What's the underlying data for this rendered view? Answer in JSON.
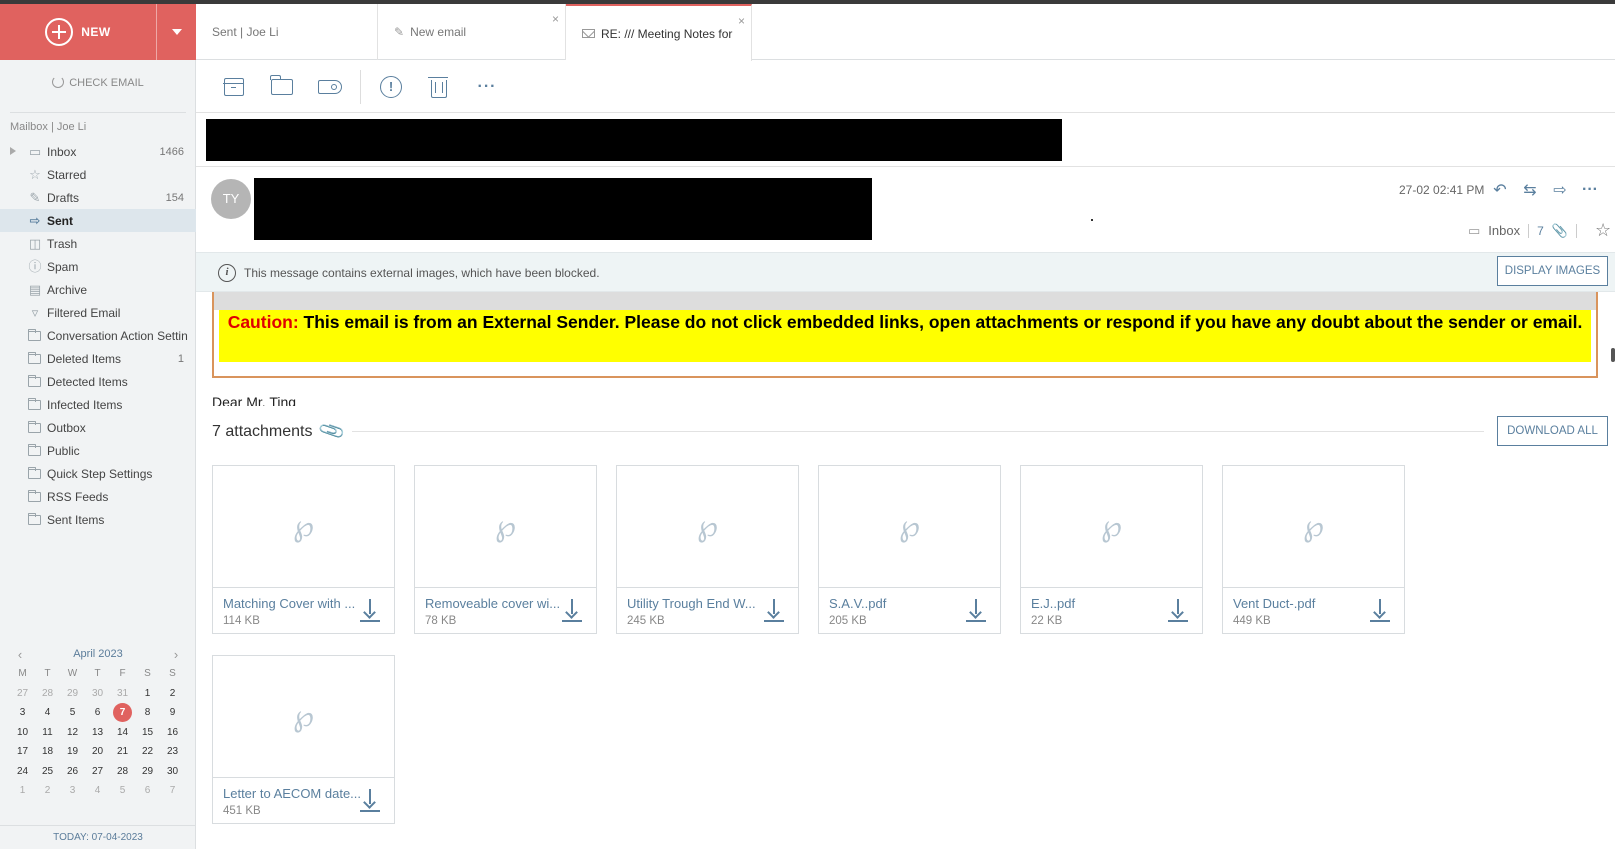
{
  "new_button": {
    "label": "NEW"
  },
  "sidebar": {
    "check_email": "CHECK EMAIL",
    "mailbox_title": "Mailbox | Joe Li",
    "folders": [
      {
        "label": "Inbox",
        "count": "1466",
        "icon": "inbox-icon"
      },
      {
        "label": "Starred",
        "count": "",
        "icon": "star-icon"
      },
      {
        "label": "Drafts",
        "count": "154",
        "icon": "drafts-icon"
      },
      {
        "label": "Sent",
        "count": "",
        "icon": "sent-icon"
      },
      {
        "label": "Trash",
        "count": "",
        "icon": "trash-icon"
      },
      {
        "label": "Spam",
        "count": "",
        "icon": "spam-icon"
      },
      {
        "label": "Archive",
        "count": "",
        "icon": "archive-icon"
      },
      {
        "label": "Filtered Email",
        "count": "",
        "icon": "filter-icon"
      },
      {
        "label": "Conversation Action Settin",
        "count": "",
        "icon": "folder-icon"
      },
      {
        "label": "Deleted Items",
        "count": "1",
        "icon": "folder-icon"
      },
      {
        "label": "Detected Items",
        "count": "",
        "icon": "folder-icon"
      },
      {
        "label": "Infected Items",
        "count": "",
        "icon": "folder-icon"
      },
      {
        "label": "Outbox",
        "count": "",
        "icon": "folder-icon"
      },
      {
        "label": "Public",
        "count": "",
        "icon": "folder-icon"
      },
      {
        "label": "Quick Step Settings",
        "count": "",
        "icon": "folder-icon"
      },
      {
        "label": "RSS Feeds",
        "count": "",
        "icon": "folder-icon"
      },
      {
        "label": "Sent Items",
        "count": "",
        "icon": "folder-icon"
      }
    ],
    "calendar": {
      "month": "April 2023",
      "dow": [
        "M",
        "T",
        "W",
        "T",
        "F",
        "S",
        "S"
      ],
      "days": [
        "27",
        "28",
        "29",
        "30",
        "31",
        "1",
        "2",
        "3",
        "4",
        "5",
        "6",
        "7",
        "8",
        "9",
        "10",
        "11",
        "12",
        "13",
        "14",
        "15",
        "16",
        "17",
        "18",
        "19",
        "20",
        "21",
        "22",
        "23",
        "24",
        "25",
        "26",
        "27",
        "28",
        "29",
        "30",
        "1",
        "2",
        "3",
        "4",
        "5",
        "6",
        "7"
      ],
      "today_label": "TODAY: 07-04-2023"
    }
  },
  "tabs": [
    {
      "label": "Sent | Joe Li"
    },
    {
      "label": "New email",
      "close": "×"
    },
    {
      "label": "RE: /// Meeting Notes for",
      "close": "×"
    }
  ],
  "message": {
    "avatar_initials": "TY",
    "date": "27-02 02:41 PM",
    "folder": "Inbox",
    "attachment_count": "7",
    "blocked_notice": "This message contains external images, which have been blocked.",
    "display_images": "DISPLAY IMAGES",
    "caution_label": "Caution:",
    "caution_text": " This email is from an External Sender. Please do not click embedded links, open attachments or respond if you have any doubt about the sender or email.",
    "greeting": "Dear Mr. Ting"
  },
  "attachments": {
    "heading": "7 attachments",
    "download_all": "DOWNLOAD ALL",
    "items": [
      {
        "name": "Matching Cover with ...",
        "size": "114 KB"
      },
      {
        "name": "Removeable cover wi...",
        "size": "78 KB"
      },
      {
        "name": "Utility Trough End W...",
        "size": "245 KB"
      },
      {
        "name": "S.A.V..pdf",
        "size": "205 KB"
      },
      {
        "name": "E.J..pdf",
        "size": "22 KB"
      },
      {
        "name": "Vent Duct-.pdf",
        "size": "449 KB"
      },
      {
        "name": "Letter to AECOM date...",
        "size": "451 KB"
      }
    ]
  }
}
